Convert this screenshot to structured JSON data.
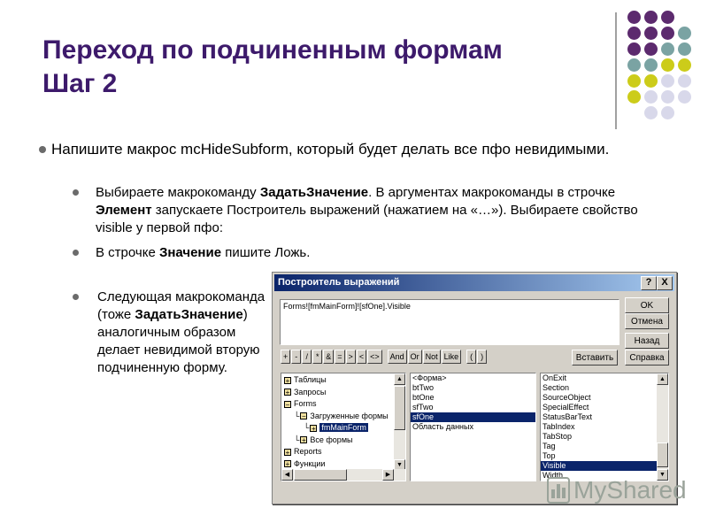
{
  "slide": {
    "title_line1": "Переход по подчиненным формам",
    "title_line2": "Шаг 2",
    "bullet1": "Напишите макрос mcHideSubform, который будет делать все пфо невидимыми.",
    "sub1": {
      "pre": "Выбираете макрокоманду ",
      "b1": "ЗадатьЗначение",
      "mid1": ". В аргументах макрокоманды в строчке ",
      "b2": "Элемент",
      "post": " запускаете Построитель выражений (нажатием на «…»). Выбираете свойство visible у первой пфо:"
    },
    "sub2": {
      "pre": "В строчке ",
      "b1": "Значение",
      "post": " пишите Ложь."
    },
    "sub3": {
      "pre": "Следующая макрокоманда (тоже ",
      "b1": "ЗадатьЗначение",
      "post": ") аналогичным образом делает невидимой вторую подчиненную форму."
    }
  },
  "colors": {
    "title": "#3d1a6b",
    "dot_purple": "#5c2a6e",
    "dot_teal": "#7aa3a3",
    "dot_yellow": "#cccc1a",
    "dot_lavender": "#d8d8ea",
    "dialog_titlebar": "#0a246a",
    "dialog_face": "#d4d0c8"
  },
  "dialog": {
    "title": "Построитель выражений",
    "help_btn": "?",
    "close_btn": "X",
    "expression": "Forms![fmMainForm]![sfOne].Visible",
    "buttons": {
      "ok": "OK",
      "cancel": "Отмена",
      "back": "Назад",
      "insert": "Вставить",
      "help": "Справка"
    },
    "operators": [
      "+",
      "-",
      "/",
      "*",
      "&",
      "=",
      ">",
      "<",
      "<>",
      "And",
      "Or",
      "Not",
      "Like",
      "(",
      ")"
    ],
    "tree": [
      {
        "label": "Таблицы",
        "icon": "plus-icon",
        "level": 0
      },
      {
        "label": "Запросы",
        "icon": "plus-icon",
        "level": 0
      },
      {
        "label": "Forms",
        "icon": "minus-icon",
        "level": 0
      },
      {
        "label": "Загруженные формы",
        "icon": "minus-icon",
        "level": 1
      },
      {
        "label": "fmMainForm",
        "icon": "plus-icon",
        "level": 2
      },
      {
        "label": "Все формы",
        "icon": "plus-icon",
        "level": 1
      },
      {
        "label": "Reports",
        "icon": "plus-icon",
        "level": 0
      },
      {
        "label": "Функции",
        "icon": "plus-icon",
        "level": 0
      }
    ],
    "objects": [
      "<Форма>",
      "btTwo",
      "btOne",
      "sfTwo",
      "sfOne",
      "Область данных"
    ],
    "objects_selected": 4,
    "properties": [
      "OnExit",
      "Section",
      "SourceObject",
      "SpecialEffect",
      "StatusBarText",
      "TabIndex",
      "TabStop",
      "Tag",
      "Top",
      "Visible",
      "Width"
    ],
    "properties_selected": 9
  },
  "watermark": {
    "text": "MyShared"
  }
}
